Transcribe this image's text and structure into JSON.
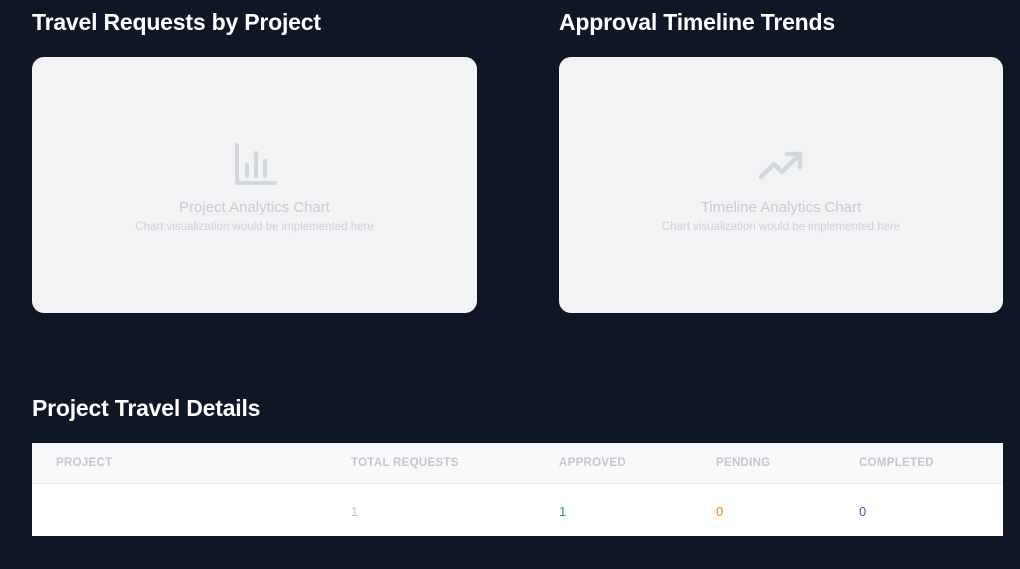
{
  "sections": {
    "projects_title": "Travel Requests by Project",
    "timeline_title": "Approval Timeline Trends",
    "details_title": "Project Travel Details"
  },
  "charts": {
    "project": {
      "icon": "bar-chart-icon",
      "title": "Project Analytics Chart",
      "subtitle": "Chart visualization would be implemented here"
    },
    "timeline": {
      "icon": "trending-up-icon",
      "title": "Timeline Analytics Chart",
      "subtitle": "Chart visualization would be implemented here"
    }
  },
  "table": {
    "headers": [
      "PROJECT",
      "TOTAL REQUESTS",
      "APPROVED",
      "PENDING",
      "COMPLETED"
    ],
    "rows": [
      {
        "project": "",
        "total": "1",
        "approved": "1",
        "pending": "0",
        "completed": "0"
      }
    ]
  },
  "colors": {
    "background": "#0f1626",
    "approved": "#2f9e5b",
    "pending": "#d98a12",
    "completed": "#2d63c8",
    "total": "#c3c7cd"
  }
}
